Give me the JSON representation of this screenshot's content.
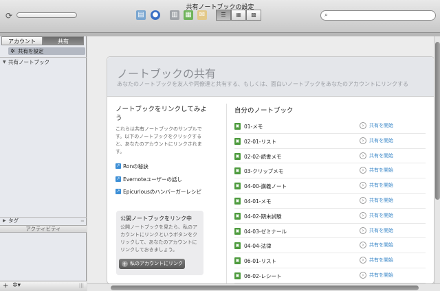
{
  "window": {
    "title": "共有ノートブックの設定"
  },
  "toolbar": {
    "search_placeholder": ""
  },
  "sidebar": {
    "tabs": [
      {
        "label": "アカウント"
      },
      {
        "label": "共有"
      }
    ],
    "settings_item": "共有を設定",
    "section_shared": "共有ノートブック",
    "section_tags": "タグ",
    "activity": "アクティビティ"
  },
  "panel": {
    "title": "ノートブックの共有",
    "subtitle": "あなたのノートブックを友人や同僚達と共有する、もしくは、面白いノートブックをあなたのアカウントにリンクする",
    "link_section": {
      "title": "ノートブックをリンクしてみよう",
      "description": "これらは共有ノートブックのサンプルです。以下のノートブックをクリックすると、あなたのアカウントにリンクされます。",
      "links": [
        {
          "label": "Ronの秘訣"
        },
        {
          "label": "Evernoteユーザーの話し"
        },
        {
          "label": "Epicuriousのハンバーガーレシピ"
        }
      ]
    },
    "infobox": {
      "title": "公開ノートブックをリンク中",
      "description": "公開ノートブックを見たら、私のアカウントにリンクというボタンをクリックして、あなたのアカウントにリンクしておきましょう。",
      "button": "私のアカウントにリンク"
    },
    "my_notebooks": {
      "title": "自分のノートブック",
      "action_label": "共有を開始",
      "items": [
        {
          "name": "01-メモ"
        },
        {
          "name": "02-01-リスト"
        },
        {
          "name": "02-02-読書メモ"
        },
        {
          "name": "03-クリップメモ"
        },
        {
          "name": "04-00-講義ノート"
        },
        {
          "name": "04-01-メモ"
        },
        {
          "name": "04-02-期末試験"
        },
        {
          "name": "04-03-ゼミナール"
        },
        {
          "name": "04-04-法律"
        },
        {
          "name": "06-01-リスト"
        },
        {
          "name": "06-02-レシート"
        }
      ]
    }
  },
  "colors": {
    "accent_link": "#3a87c8",
    "notebook_icon": "#4e9b3e"
  }
}
